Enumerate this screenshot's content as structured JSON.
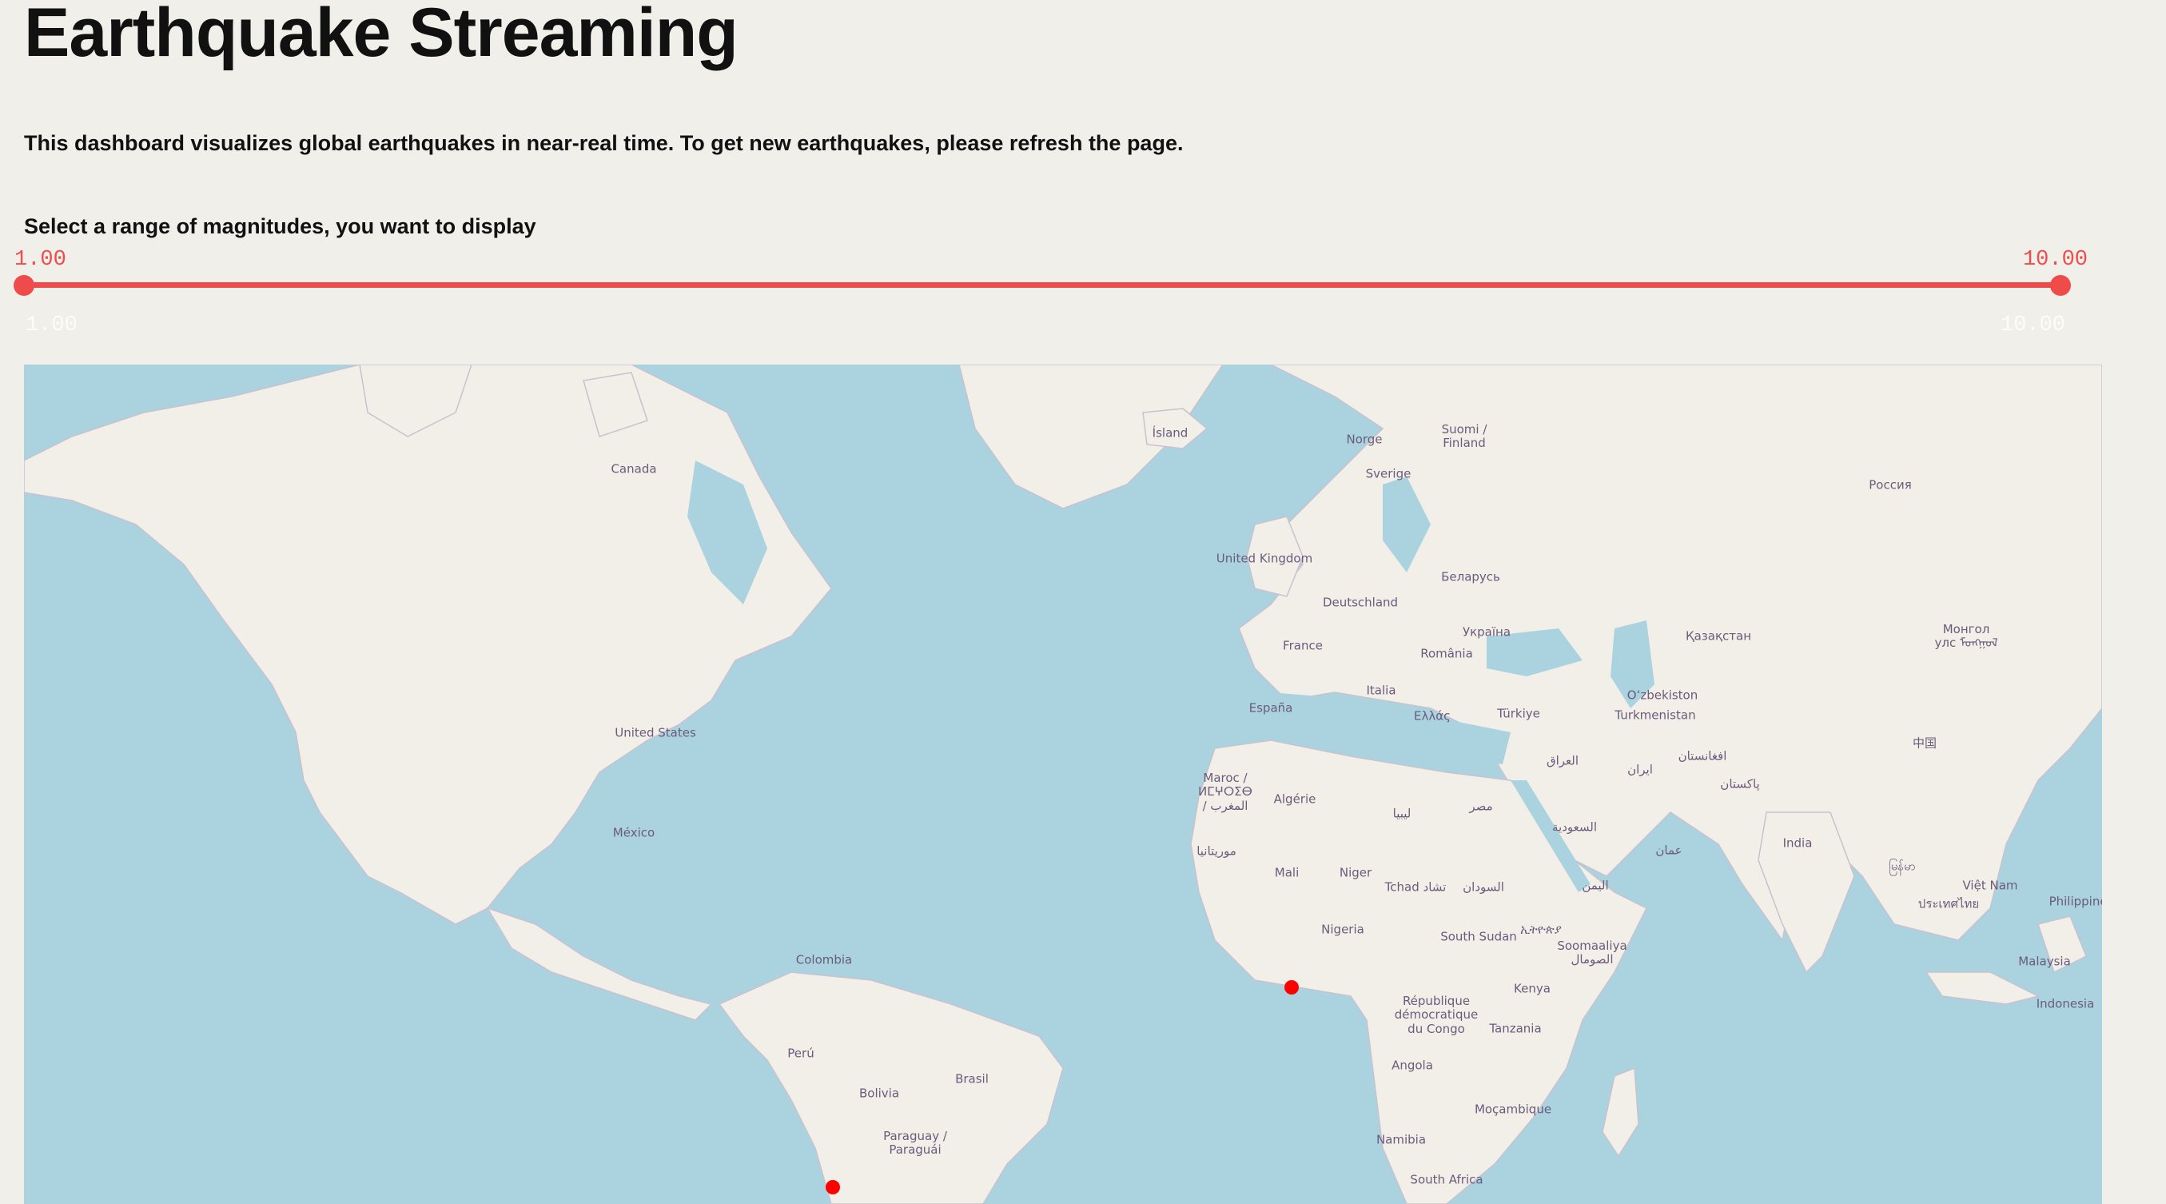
{
  "header": {
    "title": "Earthquake Streaming",
    "description": "This dashboard visualizes global earthquakes in near-real time. To get new earthquakes, please refresh the page."
  },
  "slider": {
    "label": "Select a range of magnitudes, you want to display",
    "min_value": "1.00",
    "max_value": "10.00",
    "range_min": "1.00",
    "range_max": "10.00",
    "accent_color": "#f04b4b"
  },
  "map": {
    "ocean_color": "#aad3df",
    "land_color": "#f2efe9",
    "marker_color": "#ff0000",
    "labels": [
      {
        "text": "Canada",
        "name": "label-canada"
      },
      {
        "text": "United States",
        "name": "label-united-states"
      },
      {
        "text": "México",
        "name": "label-mexico"
      },
      {
        "text": "Colombia",
        "name": "label-colombia"
      },
      {
        "text": "Perú",
        "name": "label-peru"
      },
      {
        "text": "Bolivia",
        "name": "label-bolivia"
      },
      {
        "text": "Brasil",
        "name": "label-brasil"
      },
      {
        "text": "Paraguay / Paraguái",
        "name": "label-paraguay"
      },
      {
        "text": "Ísland",
        "name": "label-island"
      },
      {
        "text": "Norge",
        "name": "label-norge"
      },
      {
        "text": "Sverige",
        "name": "label-sverige"
      },
      {
        "text": "Suomi / Finland",
        "name": "label-suomi"
      },
      {
        "text": "United Kingdom",
        "name": "label-united-kingdom"
      },
      {
        "text": "Беларусь",
        "name": "label-belarus"
      },
      {
        "text": "Deutschland",
        "name": "label-deutschland"
      },
      {
        "text": "Україна",
        "name": "label-ukraina"
      },
      {
        "text": "France",
        "name": "label-france"
      },
      {
        "text": "România",
        "name": "label-romania"
      },
      {
        "text": "Italia",
        "name": "label-italia"
      },
      {
        "text": "España",
        "name": "label-espana"
      },
      {
        "text": "Ελλάς",
        "name": "label-ellas"
      },
      {
        "text": "Türkiye",
        "name": "label-turkiye"
      },
      {
        "text": "Россия",
        "name": "label-rossiya"
      },
      {
        "text": "Қазақстан",
        "name": "label-kazakhstan"
      },
      {
        "text": "Монгол улс ᠮᠣᠩᠭᠣᠯ",
        "name": "label-mongol"
      },
      {
        "text": "Oʻzbekiston",
        "name": "label-uzbekiston"
      },
      {
        "text": "Turkmenistan",
        "name": "label-turkmenistan"
      },
      {
        "text": "افغانستان",
        "name": "label-afghanistan"
      },
      {
        "text": "پاکستان",
        "name": "label-pakistan"
      },
      {
        "text": "中国",
        "name": "label-china"
      },
      {
        "text": "India",
        "name": "label-india"
      },
      {
        "text": "ایران",
        "name": "label-iran"
      },
      {
        "text": "العراق",
        "name": "label-iraq"
      },
      {
        "text": "السعودية",
        "name": "label-saudi"
      },
      {
        "text": "عمان",
        "name": "label-oman"
      },
      {
        "text": "اليمن",
        "name": "label-yemen"
      },
      {
        "text": "مصر",
        "name": "label-egypt"
      },
      {
        "text": "ليبيا",
        "name": "label-libya"
      },
      {
        "text": "Algérie",
        "name": "label-algerie"
      },
      {
        "text": "Maroc / ⵍⵎⵖⵔⵉⴱ / المغرب",
        "name": "label-maroc"
      },
      {
        "text": "موريتانيا",
        "name": "label-mauritania"
      },
      {
        "text": "Mali",
        "name": "label-mali"
      },
      {
        "text": "Niger",
        "name": "label-niger"
      },
      {
        "text": "Tchad تشاد",
        "name": "label-tchad"
      },
      {
        "text": "السودان",
        "name": "label-sudan"
      },
      {
        "text": "Nigeria",
        "name": "label-nigeria"
      },
      {
        "text": "South Sudan",
        "name": "label-south-sudan"
      },
      {
        "text": "ኢትዮጵያ",
        "name": "label-ethiopia"
      },
      {
        "text": "Soomaaliya الصومال",
        "name": "label-somalia"
      },
      {
        "text": "Kenya",
        "name": "label-kenya"
      },
      {
        "text": "République démocratique du Congo",
        "name": "label-rdc"
      },
      {
        "text": "Tanzania",
        "name": "label-tanzania"
      },
      {
        "text": "Angola",
        "name": "label-angola"
      },
      {
        "text": "Moçambique",
        "name": "label-mocambique"
      },
      {
        "text": "Namibia",
        "name": "label-namibia"
      },
      {
        "text": "South Africa",
        "name": "label-south-africa"
      },
      {
        "text": "မြန်မာ",
        "name": "label-myanmar"
      },
      {
        "text": "ประเทศไทย",
        "name": "label-thailand"
      },
      {
        "text": "Việt Nam",
        "name": "label-vietnam"
      },
      {
        "text": "Philippines",
        "name": "label-philippines"
      },
      {
        "text": "Malaysia",
        "name": "label-malaysia"
      },
      {
        "text": "Indonesia",
        "name": "label-indonesia"
      }
    ]
  }
}
